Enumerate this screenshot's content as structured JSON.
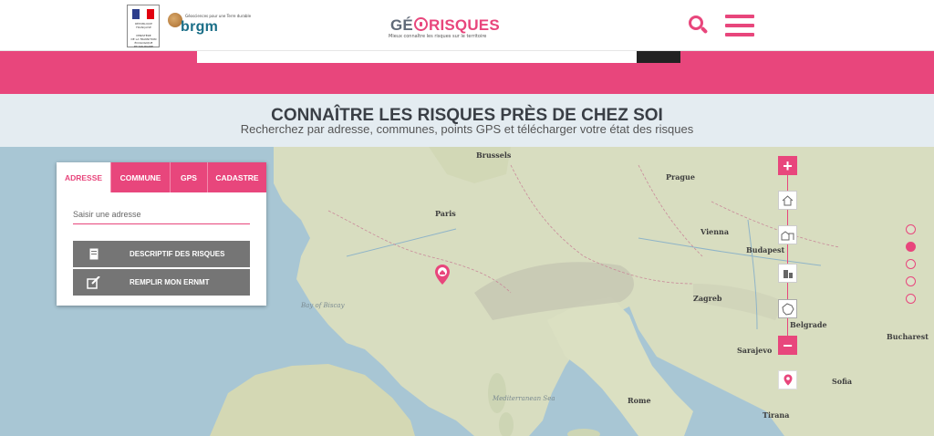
{
  "header": {
    "ministry_lines": [
      "MINISTÈRE",
      "DE LA TRANSITION",
      "ÉCOLOGIQUE",
      "ET SOLIDAIRE"
    ],
    "republic_text": "RÉPUBLIQUE FRANÇAISE",
    "brgm_subtitle": "Géosciences pour une Terre durable",
    "brgm_label": "brgm",
    "logo_left": "GÉ",
    "logo_right": "RISQUES",
    "tagline": "Mieux connaître les risques sur le territoire"
  },
  "hero": {
    "title": "CONNAÎTRE LES RISQUES PRÈS DE CHEZ SOI",
    "subtitle": "Recherchez par adresse, communes, points GPS et télécharger votre état des risques"
  },
  "search_panel": {
    "tabs": [
      {
        "label": "ADRESSE",
        "active": true
      },
      {
        "label": "COMMUNE",
        "active": false
      },
      {
        "label": "GPS",
        "active": false
      },
      {
        "label": "CADASTRE",
        "active": false
      }
    ],
    "address_placeholder": "Saisir une adresse",
    "buttons": {
      "descriptif": "DESCRIPTIF DES RISQUES",
      "remplir": "REMPLIR MON ERNMT"
    }
  },
  "map": {
    "labels": {
      "bruxelles": "Brussels",
      "paris": "Paris",
      "prague": "Prague",
      "vienna": "Vienna",
      "budapest": "Budapest",
      "zagreb": "Zagreb",
      "belgrade": "Belgrade",
      "bucharest": "Bucharest",
      "sarajevo": "Sarajevo",
      "sofia": "Sofia",
      "rome": "Rome",
      "mediterranean": "Mediterranean Sea",
      "bay_biscay": "Bay of Biscay",
      "tirana": "Tirana"
    },
    "colors": {
      "sea": "#a8c6d4",
      "land": "#d9dfc3",
      "accent": "#e8467c"
    }
  }
}
